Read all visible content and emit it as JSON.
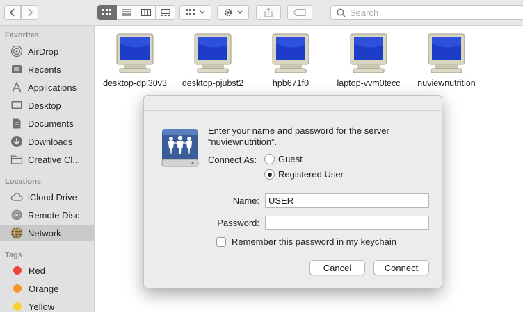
{
  "toolbar": {
    "search_placeholder": "Search"
  },
  "sidebar": {
    "favorites_header": "Favorites",
    "favorites": [
      {
        "label": "AirDrop",
        "icon": "airdrop-icon"
      },
      {
        "label": "Recents",
        "icon": "recents-icon"
      },
      {
        "label": "Applications",
        "icon": "applications-icon"
      },
      {
        "label": "Desktop",
        "icon": "desktop-icon"
      },
      {
        "label": "Documents",
        "icon": "documents-icon"
      },
      {
        "label": "Downloads",
        "icon": "downloads-icon"
      },
      {
        "label": "Creative Cl...",
        "icon": "folder-icon"
      }
    ],
    "locations_header": "Locations",
    "locations": [
      {
        "label": "iCloud Drive",
        "icon": "icloud-icon"
      },
      {
        "label": "Remote Disc",
        "icon": "disc-icon"
      },
      {
        "label": "Network",
        "icon": "network-icon",
        "selected": true
      }
    ],
    "tags_header": "Tags",
    "tags": [
      {
        "label": "Red",
        "color": "#f0443a"
      },
      {
        "label": "Orange",
        "color": "#f8962d"
      },
      {
        "label": "Yellow",
        "color": "#f6d230"
      }
    ]
  },
  "main": {
    "computers": [
      {
        "label": "desktop-dpi30v3"
      },
      {
        "label": "desktop-pjubst2"
      },
      {
        "label": "hpb671f0"
      },
      {
        "label": "laptop-vvm0tecc"
      },
      {
        "label": "nuviewnutrition"
      }
    ]
  },
  "dialog": {
    "prompt_line1": "Enter your name and password for the server",
    "prompt_line2": "“nuviewnutrition”.",
    "connect_as_label": "Connect As:",
    "guest_label": "Guest",
    "registered_label": "Registered User",
    "selected_option": "Registered User",
    "name_label": "Name:",
    "name_value": "USER",
    "password_label": "Password:",
    "password_value": "",
    "remember_label": "Remember this password in my keychain",
    "remember_checked": false,
    "cancel_label": "Cancel",
    "connect_label": "Connect"
  }
}
